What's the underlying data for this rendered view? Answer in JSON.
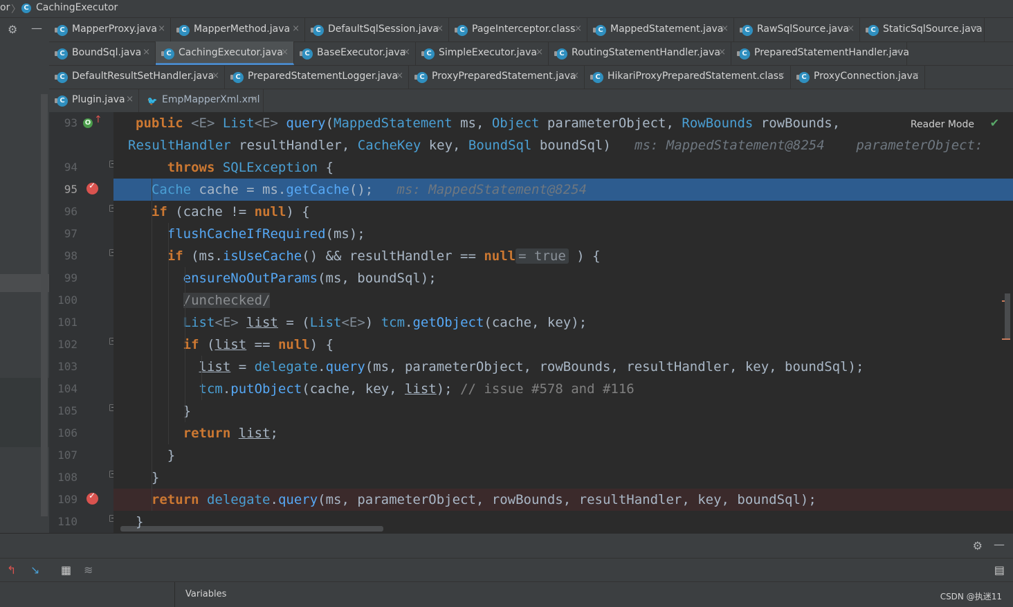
{
  "breadcrumb": {
    "parent": "or",
    "separator": "〉",
    "current": "CachingExecutor"
  },
  "tabs": [
    [
      {
        "label": "MapperProxy.java",
        "icon": "C"
      },
      {
        "label": "MapperMethod.java",
        "icon": "C"
      },
      {
        "label": "DefaultSqlSession.java",
        "icon": "C"
      },
      {
        "label": "PageInterceptor.class",
        "icon": "C"
      },
      {
        "label": "MappedStatement.java",
        "icon": "C"
      },
      {
        "label": "RawSqlSource.java",
        "icon": "C"
      },
      {
        "label": "StaticSqlSource.java",
        "icon": "C"
      }
    ],
    [
      {
        "label": "BoundSql.java",
        "icon": "C"
      },
      {
        "label": "CachingExecutor.java",
        "icon": "C",
        "active": true
      },
      {
        "label": "BaseExecutor.java",
        "icon": "C"
      },
      {
        "label": "SimpleExecutor.java",
        "icon": "C"
      },
      {
        "label": "RoutingStatementHandler.java",
        "icon": "C"
      },
      {
        "label": "PreparedStatementHandler.java",
        "icon": "C"
      }
    ],
    [
      {
        "label": "DefaultResultSetHandler.java",
        "icon": "C"
      },
      {
        "label": "PreparedStatementLogger.java",
        "icon": "C"
      },
      {
        "label": "ProxyPreparedStatement.java",
        "icon": "C"
      },
      {
        "label": "HikariProxyPreparedStatement.class",
        "icon": "C"
      },
      {
        "label": "ProxyConnection.java",
        "icon": "C"
      }
    ],
    [
      {
        "label": "Plugin.java",
        "icon": "C"
      },
      {
        "label": "EmpMapperXml.xml",
        "icon": "xml"
      }
    ]
  ],
  "tab_close": "×",
  "editor": {
    "reader_mode": "Reader Mode",
    "line_numbers": [
      "93",
      "94",
      "95",
      "96",
      "97",
      "98",
      "99",
      "100",
      "101",
      "102",
      "103",
      "104",
      "105",
      "106",
      "107",
      "108",
      "109",
      "110"
    ],
    "current_line": "95",
    "breakpoint_lines": [
      "95",
      "109"
    ],
    "override_marker_line": "93",
    "code_lines": [
      [
        [
          "kw",
          "public "
        ],
        [
          "gn",
          "<E> "
        ],
        [
          "ty",
          "List"
        ],
        [
          "gn",
          "<E> "
        ],
        [
          "fn",
          "query"
        ],
        [
          "pl",
          "("
        ],
        [
          "ty",
          "MappedStatement"
        ],
        [
          "pl",
          " ms, "
        ],
        [
          "ty",
          "Object"
        ],
        [
          "pl",
          " parameterObject, "
        ],
        [
          "ty",
          "RowBounds"
        ],
        [
          "pl",
          " rowBounds,"
        ]
      ],
      [
        [
          "ty",
          "ResultHandler"
        ],
        [
          "pl",
          " resultHandler, "
        ],
        [
          "ty",
          "CacheKey"
        ],
        [
          "pl",
          " key, "
        ],
        [
          "ty",
          "BoundSql"
        ],
        [
          "pl",
          " boundSql)   "
        ],
        [
          "hint",
          "ms: MappedStatement@8254    parameterObject:"
        ]
      ],
      [
        [
          "pl",
          "    "
        ],
        [
          "kw",
          "throws "
        ],
        [
          "ty",
          "SQLException"
        ],
        [
          "pl",
          " {"
        ]
      ],
      [
        [
          "pl",
          "  "
        ],
        [
          "ty",
          "Cache"
        ],
        [
          "pl",
          " cache = ms."
        ],
        [
          "fn",
          "getCache"
        ],
        [
          "pl",
          "();   "
        ],
        [
          "hint",
          "ms: MappedStatement@8254"
        ]
      ],
      [
        [
          "pl",
          "  "
        ],
        [
          "kw",
          "if"
        ],
        [
          "pl",
          " (cache != "
        ],
        [
          "kw",
          "null"
        ],
        [
          "pl",
          ") {"
        ]
      ],
      [
        [
          "pl",
          "    "
        ],
        [
          "fn",
          "flushCacheIfRequired"
        ],
        [
          "pl",
          "(ms);"
        ]
      ],
      [
        [
          "pl",
          "    "
        ],
        [
          "kw",
          "if"
        ],
        [
          "pl",
          " (ms."
        ],
        [
          "fn",
          "isUseCache"
        ],
        [
          "pl",
          "() && resultHandler == "
        ],
        [
          "kw",
          "null"
        ],
        [
          "inl",
          "= true"
        ],
        [
          "pl",
          " ) {"
        ]
      ],
      [
        [
          "pl",
          "      "
        ],
        [
          "fn",
          "ensureNoOutParams"
        ],
        [
          "pl",
          "(ms, boundSql);"
        ]
      ],
      [
        [
          "pl",
          "      "
        ],
        [
          "unchk",
          "/unchecked/"
        ]
      ],
      [
        [
          "pl",
          "      "
        ],
        [
          "ty",
          "List"
        ],
        [
          "gn",
          "<E> "
        ],
        [
          "ul",
          "list"
        ],
        [
          "pl",
          " = ("
        ],
        [
          "ty",
          "List"
        ],
        [
          "gn",
          "<E>"
        ],
        [
          "pl",
          ") "
        ],
        [
          "ty",
          "tcm"
        ],
        [
          "pl",
          "."
        ],
        [
          "fn",
          "getObject"
        ],
        [
          "pl",
          "(cache, key);"
        ]
      ],
      [
        [
          "pl",
          "      "
        ],
        [
          "kw",
          "if"
        ],
        [
          "pl",
          " ("
        ],
        [
          "ul",
          "list"
        ],
        [
          "pl",
          " == "
        ],
        [
          "kw",
          "null"
        ],
        [
          "pl",
          ") {"
        ]
      ],
      [
        [
          "pl",
          "        "
        ],
        [
          "ul",
          "list"
        ],
        [
          "pl",
          " = "
        ],
        [
          "ty",
          "delegate"
        ],
        [
          "pl",
          "."
        ],
        [
          "fn",
          "query"
        ],
        [
          "pl",
          "(ms, parameterObject, rowBounds, resultHandler, key, boundSql);"
        ]
      ],
      [
        [
          "pl",
          "        "
        ],
        [
          "ty",
          "tcm"
        ],
        [
          "pl",
          "."
        ],
        [
          "fn",
          "putObject"
        ],
        [
          "pl",
          "(cache, key, "
        ],
        [
          "ul",
          "list"
        ],
        [
          "pl",
          "); "
        ],
        [
          "cm",
          "// issue #578 and #116"
        ]
      ],
      [
        [
          "pl",
          "      }"
        ]
      ],
      [
        [
          "pl",
          "      "
        ],
        [
          "kw",
          "return "
        ],
        [
          "ul",
          "list"
        ],
        [
          "pl",
          ";"
        ]
      ],
      [
        [
          "pl",
          "    }"
        ]
      ],
      [
        [
          "pl",
          "  }"
        ]
      ],
      [
        [
          "pl",
          "  "
        ],
        [
          "kw",
          "return "
        ],
        [
          "ty",
          "delegate"
        ],
        [
          "pl",
          "."
        ],
        [
          "fn",
          "query"
        ],
        [
          "pl",
          "(ms, parameterObject, rowBounds, resultHandler, key, boundSql);"
        ]
      ],
      [
        [
          "pl",
          "}"
        ]
      ]
    ]
  },
  "bottom": {
    "variables_label": "Variables",
    "watermark": "CSDN @执迷11"
  },
  "icons": [
    "gear-icon",
    "minimize-icon",
    "class-icon",
    "xml-file-icon",
    "close-icon",
    "check-icon",
    "breakpoint-icon",
    "override-icon",
    "restore-layout-icon",
    "step-cursor-icon",
    "evaluate-icon",
    "trace-icon",
    "layout-icon"
  ],
  "colors": {
    "accent": "#2d5c8f",
    "keyword": "#cc7832",
    "type": "#4a9fd4",
    "breakpoint": "#d9534f"
  }
}
